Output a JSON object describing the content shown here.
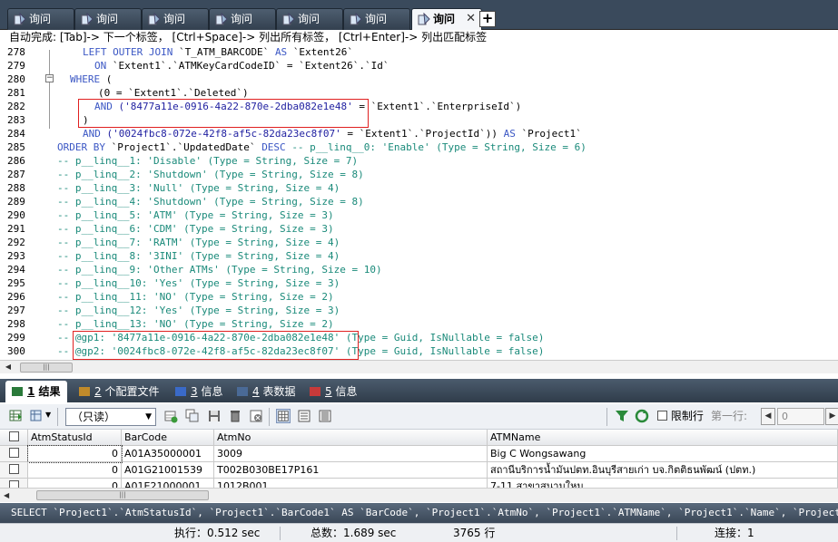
{
  "tabs": [
    {
      "label": "询问",
      "active": false
    },
    {
      "label": "询问",
      "active": false
    },
    {
      "label": "询问",
      "active": false
    },
    {
      "label": "询问",
      "active": false
    },
    {
      "label": "询问",
      "active": false
    },
    {
      "label": "询问",
      "active": false
    },
    {
      "label": "询问",
      "active": true
    }
  ],
  "tab_close": "✕",
  "tab_add": "+",
  "hint": "自动完成: [Tab]-> 下一个标签，  [Ctrl+Space]-> 列出所有标签，  [Ctrl+Enter]-> 列出匹配标签",
  "editor": {
    "lines": [
      {
        "n": "278",
        "segs": [
          [
            "kw",
            "LEFT OUTER JOIN "
          ],
          [
            "pl",
            "`T_ATM_BARCODE` "
          ],
          [
            "kw",
            "AS "
          ],
          [
            "pl",
            "`Extent26`"
          ]
        ]
      },
      {
        "n": "279",
        "segs": [
          [
            "kw",
            "ON "
          ],
          [
            "pl",
            "`Extent1`.`ATMKeyCardCodeID` = `Extent26`.`Id`"
          ]
        ]
      },
      {
        "n": "280",
        "segs": [
          [
            "kw",
            "WHERE "
          ],
          [
            "pl",
            "("
          ]
        ]
      },
      {
        "n": "281",
        "segs": [
          [
            "pl",
            "(0 = `Extent1`.`Deleted`)"
          ]
        ]
      },
      {
        "n": "282",
        "segs": [
          [
            "kw",
            "AND "
          ],
          [
            "str",
            "('8477a11e-0916-4a22-870e-2dba082e1e48'"
          ],
          [
            "pl",
            " = `Extent1`.`EnterpriseId`)"
          ]
        ]
      },
      {
        "n": "283",
        "segs": [
          [
            "pl",
            ")"
          ]
        ]
      },
      {
        "n": "284",
        "segs": [
          [
            "kw",
            "AND "
          ],
          [
            "str",
            "('0024fbc8-072e-42f8-af5c-82da23ec8f07'"
          ],
          [
            "pl",
            " = `Extent1`.`ProjectId`)) "
          ],
          [
            "kw",
            "AS "
          ],
          [
            "pl",
            "`Project1`"
          ]
        ]
      },
      {
        "n": "285",
        "segs": [
          [
            "kw",
            "ORDER BY "
          ],
          [
            "pl",
            "`Project1`.`UpdatedDate` "
          ],
          [
            "kw",
            "DESC "
          ],
          [
            "cm",
            "-- p__linq__0: 'Enable' (Type = String, Size = 6)"
          ]
        ]
      },
      {
        "n": "286",
        "segs": [
          [
            "cm",
            "-- p__linq__1: 'Disable' (Type = String, Size = 7)"
          ]
        ]
      },
      {
        "n": "287",
        "segs": [
          [
            "cm",
            "-- p__linq__2: 'Shutdown' (Type = String, Size = 8)"
          ]
        ]
      },
      {
        "n": "288",
        "segs": [
          [
            "cm",
            "-- p__linq__3: 'Null' (Type = String, Size = 4)"
          ]
        ]
      },
      {
        "n": "289",
        "segs": [
          [
            "cm",
            "-- p__linq__4: 'Shutdown' (Type = String, Size = 8)"
          ]
        ]
      },
      {
        "n": "290",
        "segs": [
          [
            "cm",
            "-- p__linq__5: 'ATM' (Type = String, Size = 3)"
          ]
        ]
      },
      {
        "n": "291",
        "segs": [
          [
            "cm",
            "-- p__linq__6: 'CDM' (Type = String, Size = 3)"
          ]
        ]
      },
      {
        "n": "292",
        "segs": [
          [
            "cm",
            "-- p__linq__7: 'RATM' (Type = String, Size = 4)"
          ]
        ]
      },
      {
        "n": "293",
        "segs": [
          [
            "cm",
            "-- p__linq__8: '3INI' (Type = String, Size = 4)"
          ]
        ]
      },
      {
        "n": "294",
        "segs": [
          [
            "cm",
            "-- p__linq__9: 'Other ATMs' (Type = String, Size = 10)"
          ]
        ]
      },
      {
        "n": "295",
        "segs": [
          [
            "cm",
            "-- p__linq__10: 'Yes' (Type = String, Size = 3)"
          ]
        ]
      },
      {
        "n": "296",
        "segs": [
          [
            "cm",
            "-- p__linq__11: 'NO' (Type = String, Size = 2)"
          ]
        ]
      },
      {
        "n": "297",
        "segs": [
          [
            "cm",
            "-- p__linq__12: 'Yes' (Type = String, Size = 3)"
          ]
        ]
      },
      {
        "n": "298",
        "segs": [
          [
            "cm",
            "-- p__linq__13: 'NO' (Type = String, Size = 2)"
          ]
        ]
      },
      {
        "n": "299",
        "segs": [
          [
            "cm",
            "-- @gp1: '8477a11e-0916-4a22-870e-2dba082e1e48' (Type = Guid, IsNullable = false)"
          ]
        ]
      },
      {
        "n": "300",
        "segs": [
          [
            "cm",
            "-- @gp2: '0024fbc8-072e-42f8-af5c-82da23ec8f07' (Type = Guid, IsNullable = false)"
          ]
        ]
      }
    ]
  },
  "result_tabs": [
    {
      "num": "1",
      "label": "结果",
      "active": true
    },
    {
      "num": "2",
      "label": "个配置文件",
      "active": false
    },
    {
      "num": "3",
      "label": "信息",
      "active": false
    },
    {
      "num": "4",
      "label": "表数据",
      "active": false
    },
    {
      "num": "5",
      "label": "信息",
      "active": false
    }
  ],
  "toolbar": {
    "mode": "（只读）",
    "limit_label": "限制行",
    "first_row_label": "第一行:",
    "first_row_value": "0"
  },
  "grid": {
    "columns": [
      "AtmStatusId",
      "BarCode",
      "AtmNo",
      "ATMName"
    ],
    "rows": [
      [
        "0",
        "A01A35000001",
        "3009",
        "Big C Wongsawang"
      ],
      [
        "0",
        "A01G21001539",
        "T002B030BE17P161",
        "สถานีบริการน้ำมันปตท.อินบุรีสายเก่า บจ.กิตติธนพัฒน์ (ปตท.)"
      ],
      [
        "0",
        "A01E21000001",
        "1012B001",
        "7-11 สาขาสนามใหม"
      ]
    ]
  },
  "sql_line": "SELECT `Project1`.`AtmStatusId`, `Project1`.`BarCode1` AS `BarCode`, `Project1`.`AtmNo`, `Project1`.`ATMName`, `Project1`.`Name`, `Project...",
  "status": {
    "exec": "执行：0.512 sec",
    "total": "总数：1.689 sec",
    "rows": "3765 行",
    "conn": "连接：1"
  }
}
